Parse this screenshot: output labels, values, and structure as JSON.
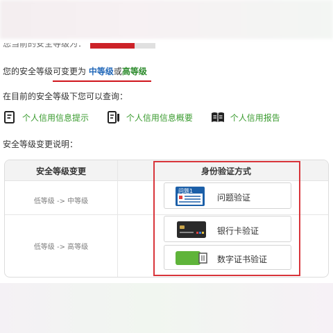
{
  "top_partial": {
    "text": "您当前的安全等级为："
  },
  "security_change": {
    "prefix": "您的安全等级",
    "highlight_prefix": "可变更为",
    "level_mid": "中等级",
    "connector": "或",
    "level_high": "高等级"
  },
  "query_intro": "在目前的安全等级下您可以查询：",
  "links": [
    {
      "label": "个人信用信息提示",
      "icon": "document-icon"
    },
    {
      "label": "个人信用信息概要",
      "icon": "document-pen-icon"
    },
    {
      "label": "个人信用报告",
      "icon": "book-icon"
    }
  ],
  "change_note_title": "安全等级变更说明：",
  "table": {
    "header_change": "安全等级变更",
    "header_method": "身份验证方式",
    "rows": [
      {
        "change": "低等级 -> 中等级"
      },
      {
        "change": "低等级 -> 高等级"
      }
    ]
  },
  "methods": [
    {
      "label": "问题验证",
      "icon": "question-card-icon",
      "icon_text": "问题1"
    },
    {
      "label": "银行卡验证",
      "icon": "bank-card-icon"
    },
    {
      "label": "数字证书验证",
      "icon": "usb-key-icon"
    }
  ],
  "colors": {
    "accent_red": "#d8343a",
    "link_green": "#3a9b2f",
    "level_blue": "#1f66b8",
    "level_green": "#2b8a2b"
  }
}
